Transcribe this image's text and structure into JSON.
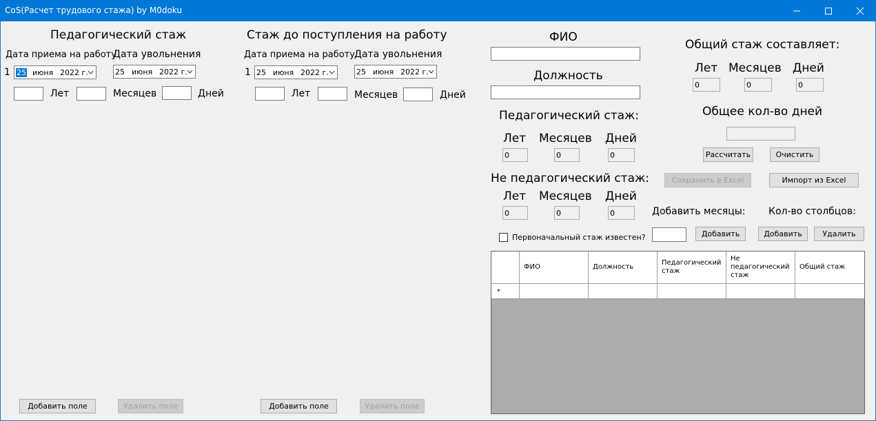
{
  "window": {
    "title": "CoS(Расчет трудового стажа) by M0doku"
  },
  "pedagogical_panel": {
    "heading": "Педагогический стаж",
    "hire_label": "Дата приема на работу",
    "fire_label": "Дата увольнения",
    "row_number": "1",
    "hire_date": {
      "day": "25",
      "month": "июня",
      "year": "2022 г."
    },
    "fire_date": {
      "day": "25",
      "month": "июня",
      "year": "2022 г."
    },
    "years_label": "Лет",
    "months_label": "Месяцев",
    "days_label": "Дней",
    "years_value": "",
    "months_value": "",
    "days_value": "",
    "add_button": "Добавить поле",
    "remove_button": "Удалить поле"
  },
  "previous_panel": {
    "heading": "Стаж до поступления на работу",
    "hire_label": "Дата приема на работу",
    "fire_label": "Дата увольнения",
    "row_number": "1",
    "hire_date": {
      "day": "25",
      "month": "июня",
      "year": "2022 г."
    },
    "fire_date": {
      "day": "25",
      "month": "июня",
      "year": "2022 г."
    },
    "years_label": "Лет",
    "months_label": "Месяцев",
    "days_label": "Дней",
    "years_value": "",
    "months_value": "",
    "days_value": "",
    "add_button": "Добавить поле",
    "remove_button": "Удалить поле"
  },
  "person": {
    "fio_label": "ФИО",
    "fio_value": "",
    "position_label": "Должность",
    "position_value": ""
  },
  "ped_summary": {
    "heading": "Педагогический стаж:",
    "years_label": "Лет",
    "months_label": "Месяцев",
    "days_label": "Дней",
    "years": "0",
    "months": "0",
    "days": "0"
  },
  "nonped_summary": {
    "heading": "Не педагогический стаж:",
    "years_label": "Лет",
    "months_label": "Месяцев",
    "days_label": "Дней",
    "years": "0",
    "months": "0",
    "days": "0"
  },
  "known_checkbox_label": "Первоначальный стаж известен?",
  "total": {
    "heading": "Общий стаж составляет:",
    "years_label": "Лет",
    "months_label": "Месяцев",
    "days_label": "Дней",
    "years": "0",
    "months": "0",
    "days": "0",
    "total_days_label": "Общее кол-во дней",
    "total_days_value": ""
  },
  "actions": {
    "calculate": "Рассчитать",
    "clear": "Очистить",
    "save_excel": "Сохранить в Excel",
    "import_excel": "Импорт из Excel"
  },
  "add_months": {
    "label": "Добавить месяцы:",
    "value": "",
    "button": "Добавить"
  },
  "columns": {
    "label": "Кол-во столбцов:",
    "add_button": "Добавить",
    "remove_button": "Удалить"
  },
  "grid": {
    "headers": [
      "ФИО",
      "Должность",
      "Педагогический стаж",
      "Не педагогический стаж",
      "Общий стаж"
    ],
    "new_row_marker": "*"
  },
  "colors": {
    "titlebar": "#0078d7",
    "background": "#f0f0f0",
    "grid_background": "#ababab"
  }
}
